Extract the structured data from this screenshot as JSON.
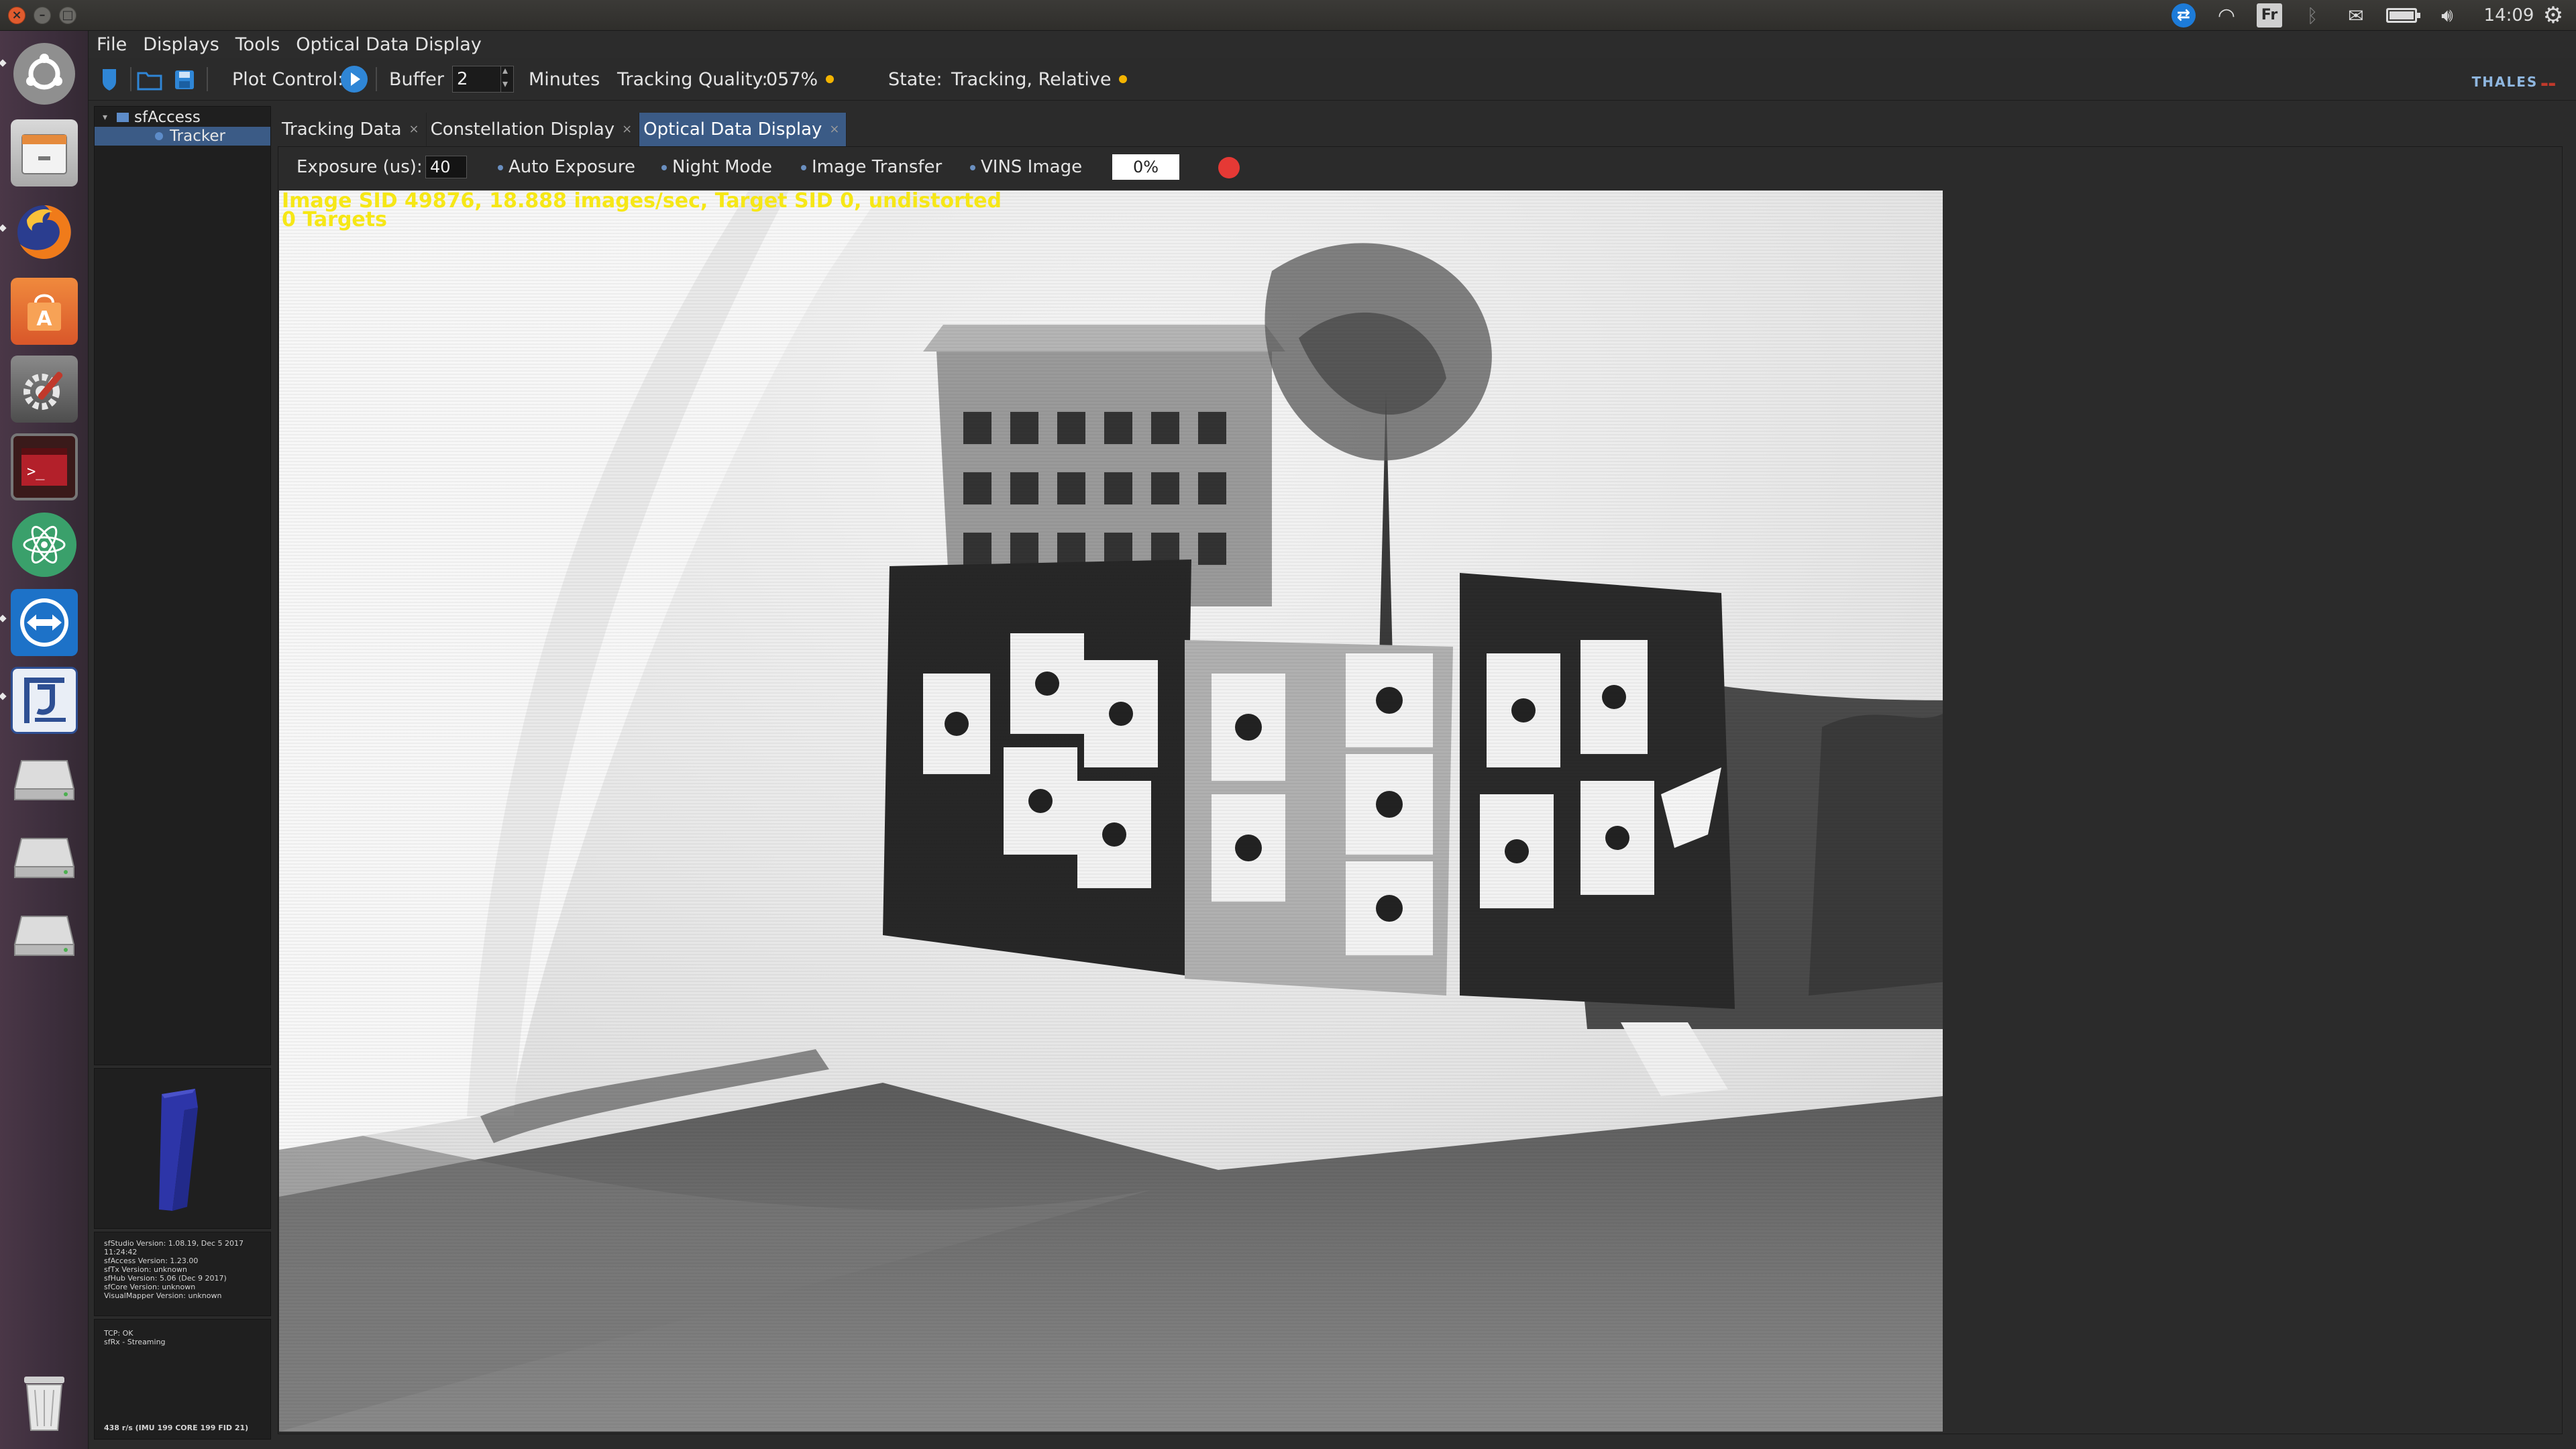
{
  "system": {
    "clock": "14:09",
    "keyboard_layout": "Fr"
  },
  "menu": {
    "file": "File",
    "displays": "Displays",
    "tools": "Tools",
    "optical": "Optical Data Display"
  },
  "toolbar": {
    "plot_control_label": "Plot Control:",
    "buffer_label": "Buffer",
    "buffer_value": "2",
    "minutes_label": "Minutes",
    "tracking_quality_label": "Tracking Quality:",
    "tracking_quality_value": "057%",
    "state_label": "State:",
    "state_value": "Tracking, Relative",
    "brand": "THALES"
  },
  "tree": {
    "root": "sfAccess",
    "child": "Tracker"
  },
  "version_info": [
    "sfStudio Version: 1.08.19, Dec 5 2017",
    "11:24:42",
    "sfAccess Version: 1.23.00",
    "sfTx Version: unknown",
    "sfHub Version: 5.06 (Dec 9 2017)",
    "sfCore Version: unknown",
    "VisualMapper Version: unknown"
  ],
  "status_info": {
    "tcp": "TCP: OK",
    "sfrx": "sfRx - Streaming",
    "rates": "438 r/s (IMU 199  CORE 199  FID 21)"
  },
  "tabs": [
    {
      "label": "Tracking Data"
    },
    {
      "label": "Constellation Display"
    },
    {
      "label": "Optical Data Display"
    }
  ],
  "optical": {
    "exposure_label": "Exposure (us):",
    "exposure_value": "40",
    "auto_exposure": "Auto Exposure",
    "night_mode": "Night Mode",
    "image_transfer": "Image Transfer",
    "vins_image": "VINS Image",
    "progress": "0%",
    "overlay_line1": "Image SID 49876, 18.888 images/sec, Target SID 0, undistorted",
    "overlay_line2": "0 Targets"
  },
  "colors": {
    "accent": "#3b5b86",
    "record": "#e53935",
    "status_dot": "#f4b400",
    "overlay_text": "#f6e716"
  }
}
